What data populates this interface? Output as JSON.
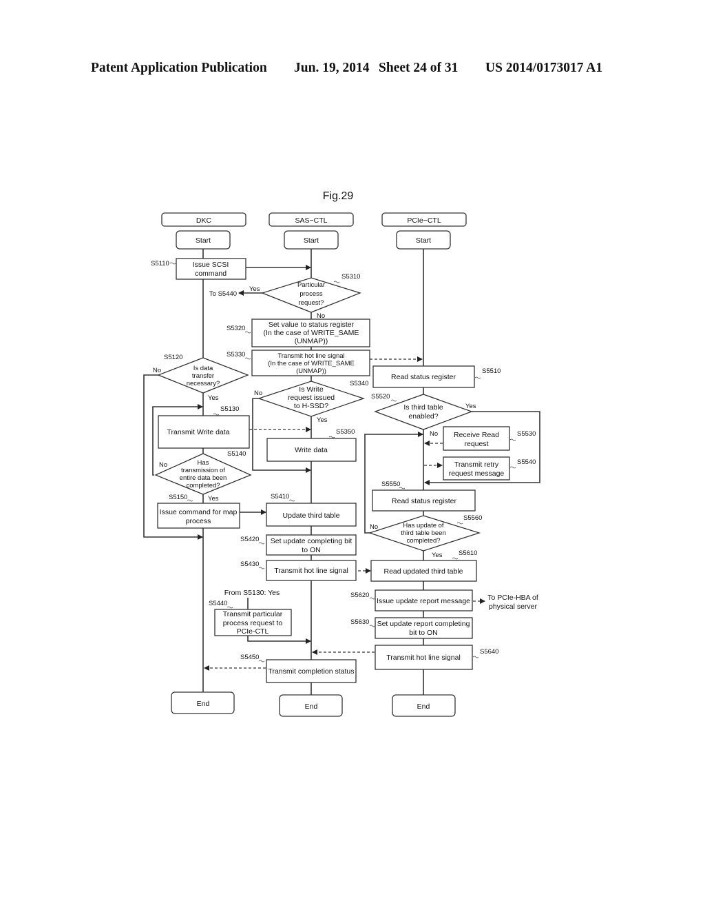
{
  "header": {
    "publication": "Patent Application Publication",
    "date": "Jun. 19, 2014",
    "sheet": "Sheet 24 of 31",
    "number": "US 2014/0173017 A1"
  },
  "figure": {
    "title": "Fig.29",
    "lanes": [
      "DKC",
      "SAS−CTL",
      "PCIe−CTL"
    ],
    "terminals": {
      "start": "Start",
      "end": "End"
    },
    "steps": {
      "S5110": {
        "id": "S5110",
        "lines": [
          "Issue SCSI",
          "command"
        ]
      },
      "S5120": {
        "id": "S5120",
        "lines": [
          "Is data",
          "transfer",
          "necessary?"
        ]
      },
      "S5130": {
        "id": "S5130",
        "lines": [
          "Transmit Write data"
        ]
      },
      "S5140": {
        "id": "S5140",
        "lines": [
          "Has",
          "transmission of",
          "entire data been",
          "completed?"
        ]
      },
      "S5150": {
        "id": "S5150",
        "lines": [
          "Issue command for map",
          "process"
        ]
      },
      "S5310": {
        "id": "S5310",
        "lines": [
          "Particular",
          "process",
          "request?"
        ]
      },
      "S5320": {
        "id": "S5320",
        "lines": [
          "Set value to status register",
          "(In the case of WRITE_SAME",
          "(UNMAP))"
        ]
      },
      "S5330": {
        "id": "S5330",
        "lines": [
          "Transmit hot line signal",
          "(In the case of WRITE_SAME",
          "(UNMAP))"
        ]
      },
      "S5340": {
        "id": "S5340",
        "lines": [
          "Is Write",
          "request issued",
          "to H-SSD?"
        ]
      },
      "S5350": {
        "id": "S5350",
        "lines": [
          "Write data"
        ]
      },
      "S5410": {
        "id": "S5410",
        "lines": [
          "Update third table"
        ]
      },
      "S5420": {
        "id": "S5420",
        "lines": [
          "Set update completing bit",
          "to ON"
        ]
      },
      "S5430": {
        "id": "S5430",
        "lines": [
          "Transmit hot line signal"
        ]
      },
      "S5440": {
        "id": "S5440",
        "lines": [
          "Transmit particular",
          "process request to",
          "PCIe-CTL"
        ]
      },
      "S5450": {
        "id": "S5450",
        "lines": [
          "Transmit completion status"
        ]
      },
      "S5510": {
        "id": "S5510",
        "lines": [
          "Read status register"
        ]
      },
      "S5520": {
        "id": "S5520",
        "lines": [
          "Is third table",
          "enabled?"
        ]
      },
      "S5530": {
        "id": "S5530",
        "lines": [
          "Receive Read",
          "request"
        ]
      },
      "S5540": {
        "id": "S5540",
        "lines": [
          "Transmit retry",
          "request message"
        ]
      },
      "S5550": {
        "id": "S5550",
        "lines": [
          "Read status register"
        ]
      },
      "S5560": {
        "id": "S5560",
        "lines": [
          "Has update of",
          "third table been",
          "completed?"
        ]
      },
      "S5610": {
        "id": "S5610",
        "lines": [
          "Read updated third table"
        ]
      },
      "S5620": {
        "id": "S5620",
        "lines": [
          "Issue update report message"
        ]
      },
      "S5630": {
        "id": "S5630",
        "lines": [
          "Set update report completing",
          "bit to ON"
        ]
      },
      "S5640": {
        "id": "S5640",
        "lines": [
          "Transmit hot line signal"
        ]
      }
    },
    "step_labels": {
      "S5620": "S5620"
    },
    "annotations": {
      "yes": "Yes",
      "no": "No",
      "to_s5440": "To S5440",
      "from_s5130": "From S5130: Yes",
      "to_pcie_hba": [
        "To PCIe-HBA of",
        "physical server"
      ]
    }
  }
}
